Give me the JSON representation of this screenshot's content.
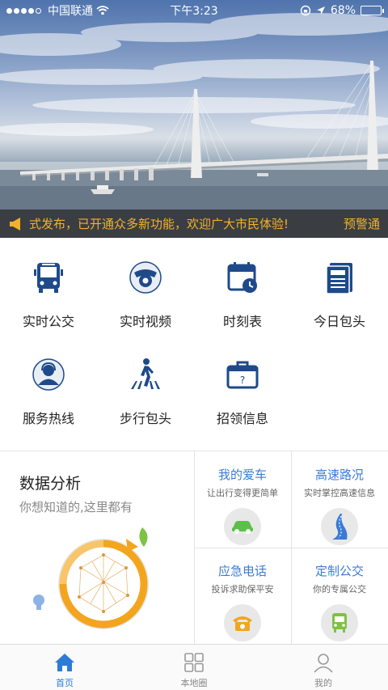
{
  "status_bar": {
    "carrier": "中国联通",
    "time": "下午3:23",
    "battery": "68%",
    "battery_level": 0.68
  },
  "hero": {
    "notice_text": "式发布，已开通众多新功能，欢迎广大市民体验!",
    "notice_link": "预警通"
  },
  "grid": {
    "items": [
      {
        "label": "实时公交",
        "icon": "bus-icon"
      },
      {
        "label": "实时视频",
        "icon": "camera-icon"
      },
      {
        "label": "时刻表",
        "icon": "schedule-icon"
      },
      {
        "label": "今日包头",
        "icon": "news-icon"
      },
      {
        "label": "服务热线",
        "icon": "service-icon"
      },
      {
        "label": "步行包头",
        "icon": "walk-icon"
      },
      {
        "label": "招领信息",
        "icon": "lost-found-icon"
      }
    ]
  },
  "analysis": {
    "title": "数据分析",
    "subtitle": "你想知道的,这里都有"
  },
  "cards": [
    {
      "title": "我的爱车",
      "subtitle": "让出行变得更简单",
      "icon": "car-icon",
      "color": "#5cbf4a"
    },
    {
      "title": "高速路况",
      "subtitle": "实时掌控高速信息",
      "icon": "road-icon",
      "color": "#3a7bd5"
    },
    {
      "title": "应急电话",
      "subtitle": "投诉求助保平安",
      "icon": "phone-icon",
      "color": "#f3a51d"
    },
    {
      "title": "定制公交",
      "subtitle": "你的专属公交",
      "icon": "custom-bus-icon",
      "color": "#7cc243"
    }
  ],
  "tabbar": {
    "tabs": [
      {
        "label": "首页",
        "icon": "home-icon",
        "active": true
      },
      {
        "label": "本地圈",
        "icon": "grid-icon",
        "active": false
      },
      {
        "label": "我的",
        "icon": "user-icon",
        "active": false
      }
    ]
  },
  "colors": {
    "accent": "#2e7bd6",
    "icon_blue": "#1e4a8a",
    "notice": "#f3b12a"
  }
}
